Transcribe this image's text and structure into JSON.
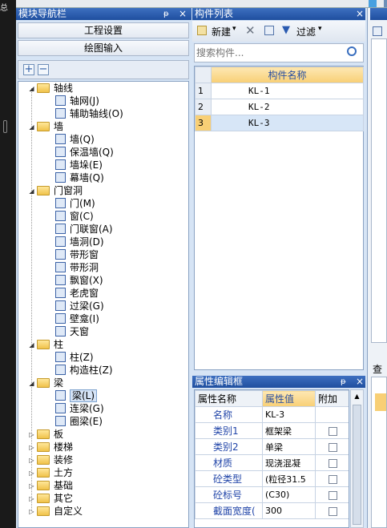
{
  "left_strip_label": "总",
  "left_panel": {
    "title": "模块导航栏",
    "pin": "ᵽ",
    "close": "×",
    "buttons": [
      "工程设置",
      "绘图输入"
    ],
    "toolbar": {
      "add": "+",
      "remove": "−"
    },
    "tree": [
      {
        "label": "轴线",
        "level": 0,
        "expanded": true
      },
      {
        "label": "轴网(J)",
        "level": 1,
        "icon": "grid-icon"
      },
      {
        "label": "辅助轴线(O)",
        "level": 1,
        "icon": "aux-axis-icon"
      },
      {
        "label": "墙",
        "level": 0,
        "expanded": true
      },
      {
        "label": "墙(Q)",
        "level": 1,
        "icon": "wall-icon"
      },
      {
        "label": "保温墙(Q)",
        "level": 1,
        "icon": "insulation-wall-icon"
      },
      {
        "label": "墙垛(E)",
        "level": 1,
        "icon": "pilaster-icon"
      },
      {
        "label": "幕墙(Q)",
        "level": 1,
        "icon": "curtain-wall-icon"
      },
      {
        "label": "门窗洞",
        "level": 0,
        "expanded": true
      },
      {
        "label": "门(M)",
        "level": 1,
        "icon": "door-icon"
      },
      {
        "label": "窗(C)",
        "level": 1,
        "icon": "window-icon"
      },
      {
        "label": "门联窗(A)",
        "level": 1,
        "icon": "door-window-icon"
      },
      {
        "label": "墙洞(D)",
        "level": 1,
        "icon": "wall-opening-icon"
      },
      {
        "label": "带形窗",
        "level": 1,
        "icon": "strip-window-icon"
      },
      {
        "label": "带形洞",
        "level": 1,
        "icon": "strip-opening-icon"
      },
      {
        "label": "飘窗(X)",
        "level": 1,
        "icon": "bay-window-icon"
      },
      {
        "label": "老虎窗",
        "level": 1,
        "icon": "dormer-icon"
      },
      {
        "label": "过梁(G)",
        "level": 1,
        "icon": "lintel-icon"
      },
      {
        "label": "壁龛(I)",
        "level": 1,
        "icon": "niche-icon"
      },
      {
        "label": "天窗",
        "level": 1,
        "icon": "skylight-icon"
      },
      {
        "label": "柱",
        "level": 0,
        "expanded": true
      },
      {
        "label": "柱(Z)",
        "level": 1,
        "icon": "column-icon"
      },
      {
        "label": "构造柱(Z)",
        "level": 1,
        "icon": "structural-column-icon"
      },
      {
        "label": "梁",
        "level": 0,
        "expanded": true
      },
      {
        "label": "梁(L)",
        "level": 1,
        "icon": "beam-icon",
        "selected": true
      },
      {
        "label": "连梁(G)",
        "level": 1,
        "icon": "coupling-beam-icon"
      },
      {
        "label": "圈梁(E)",
        "level": 1,
        "icon": "ring-beam-icon"
      },
      {
        "label": "板",
        "level": 0,
        "expanded": false
      },
      {
        "label": "楼梯",
        "level": 0,
        "expanded": false
      },
      {
        "label": "装修",
        "level": 0,
        "expanded": false
      },
      {
        "label": "土方",
        "level": 0,
        "expanded": false
      },
      {
        "label": "基础",
        "level": 0,
        "expanded": false
      },
      {
        "label": "其它",
        "level": 0,
        "expanded": false
      },
      {
        "label": "自定义",
        "level": 0,
        "expanded": false
      }
    ]
  },
  "component_list": {
    "title": "构件列表",
    "close": "×",
    "toolbar": {
      "new_label": "新建",
      "filter_label": "过滤"
    },
    "search_placeholder": "搜索构件...",
    "header": "构件名称",
    "rows": [
      {
        "index": "1",
        "name": "KL-1"
      },
      {
        "index": "2",
        "name": "KL-2"
      },
      {
        "index": "3",
        "name": "KL-3",
        "selected": true
      }
    ]
  },
  "property_editor": {
    "title": "属性编辑框",
    "pin": "ᵽ",
    "close": "×",
    "headers": [
      "属性名称",
      "属性值",
      "附加"
    ],
    "rows": [
      {
        "name": "名称",
        "value": "KL-3"
      },
      {
        "name": "类别1",
        "value": "框架梁"
      },
      {
        "name": "类别2",
        "value": "单梁"
      },
      {
        "name": "材质",
        "value": "现浇混凝"
      },
      {
        "name": "砼类型",
        "value": "(粒径31.5"
      },
      {
        "name": "砼标号",
        "value": "(C30)"
      },
      {
        "name": "截面宽度(",
        "value": "300"
      }
    ]
  },
  "right_panel": {
    "label": "查"
  }
}
